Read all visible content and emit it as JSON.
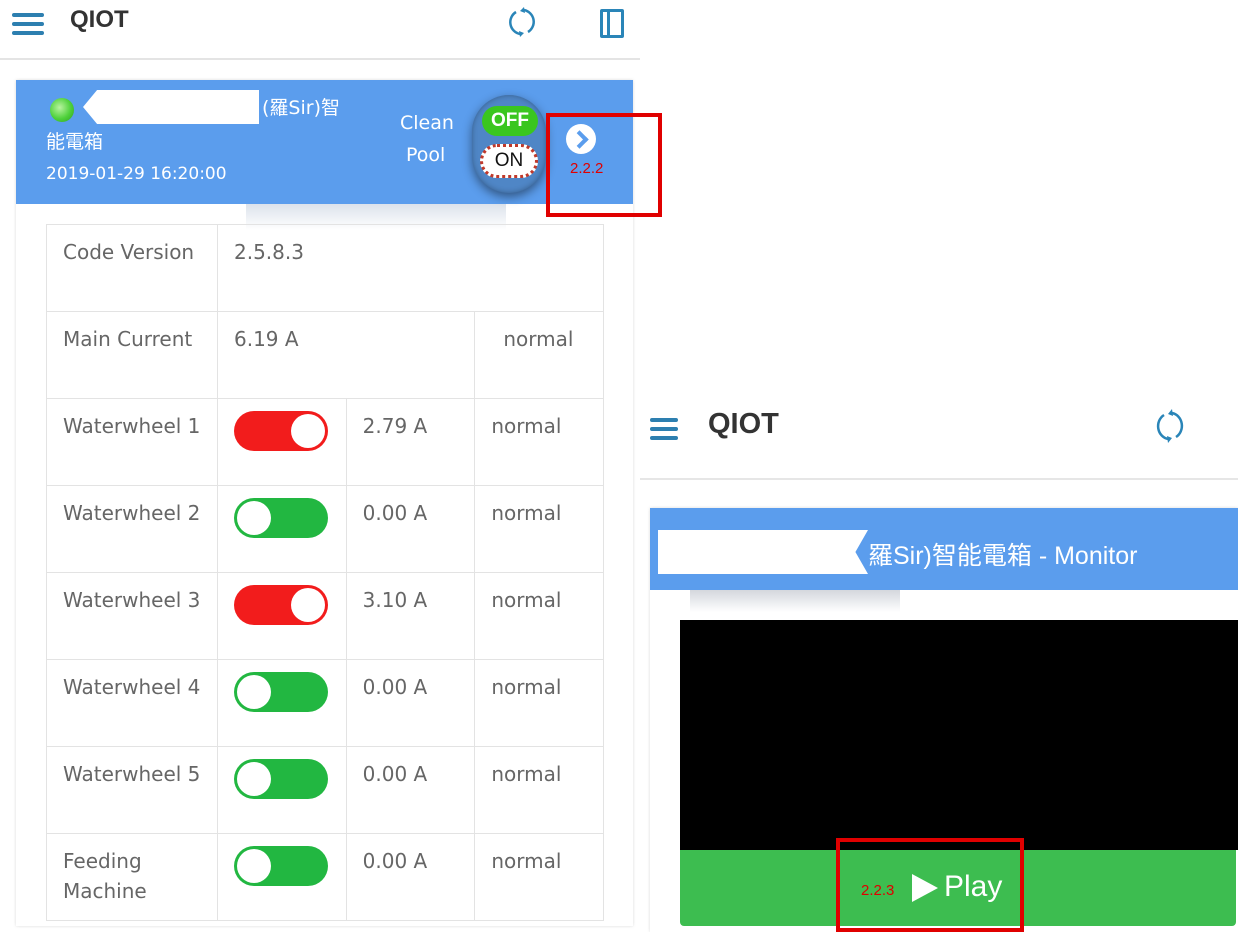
{
  "left": {
    "appbar": {
      "title": "QIOT",
      "icons": [
        "menu-icon",
        "refresh-icon",
        "book-icon"
      ]
    },
    "device": {
      "name_line1": "(羅Sir)智",
      "name_line2": "能電箱",
      "datetime": "2019-01-29 16:20:00",
      "clean_label_1": "Clean",
      "clean_label_2": "Pool",
      "off_label": "OFF",
      "on_label": "ON",
      "status_led_color": "#4ed13a"
    },
    "info": {
      "code_label": "Code Version",
      "code_value": "2.5.8.3",
      "main_label": "Main Current",
      "main_value": "6.19 A",
      "main_status": "normal",
      "rows": [
        {
          "label": "Waterwheel 1",
          "switch": "on",
          "value": "2.79 A",
          "status": "normal"
        },
        {
          "label": "Waterwheel 2",
          "switch": "off",
          "value": "0.00 A",
          "status": "normal"
        },
        {
          "label": "Waterwheel 3",
          "switch": "on",
          "value": "3.10 A",
          "status": "normal"
        },
        {
          "label": "Waterwheel 4",
          "switch": "off",
          "value": "0.00 A",
          "status": "normal"
        },
        {
          "label": "Waterwheel 5",
          "switch": "off",
          "value": "0.00 A",
          "status": "normal"
        },
        {
          "label": "Feeding Machine",
          "switch": "off",
          "value": "0.00 A",
          "status": "normal"
        }
      ]
    }
  },
  "right": {
    "appbar": {
      "title": "QIOT",
      "icons": [
        "menu-icon",
        "refresh-icon"
      ]
    },
    "monitor_title": "羅Sir)智能電箱 - Monitor",
    "play_label": "Play"
  },
  "annotations": {
    "a1": "2.2.2",
    "a2": "2.2.3"
  },
  "colors": {
    "header_blue": "#5b9ded",
    "switch_on_red": "#f21c1c",
    "switch_off_green": "#22b741",
    "play_green": "#3dbd50",
    "annotation_red": "#e00000"
  }
}
